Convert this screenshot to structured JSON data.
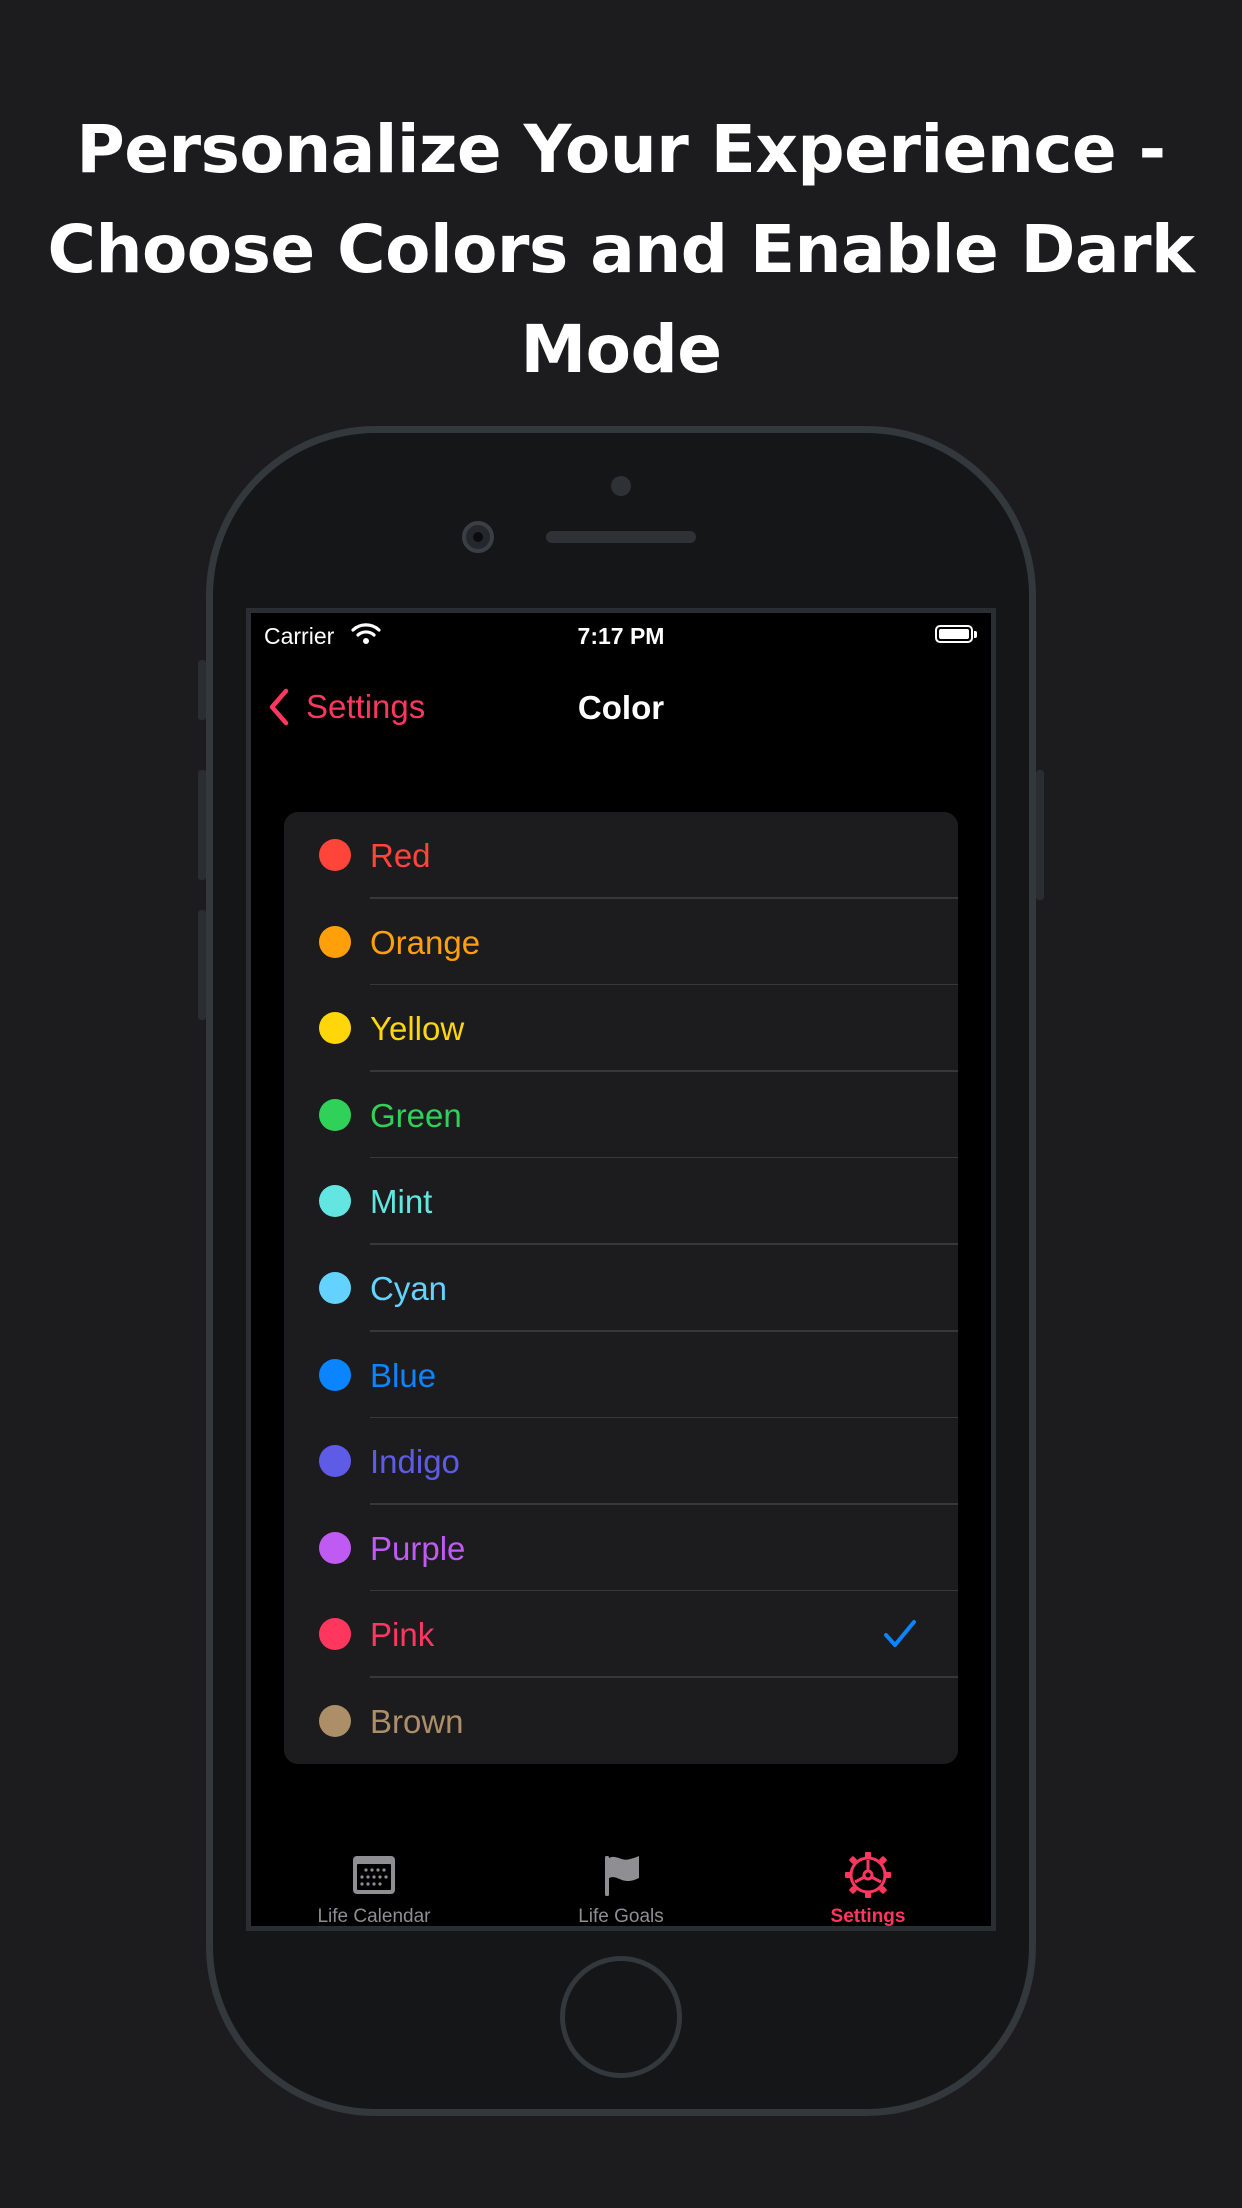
{
  "headline": {
    "line1": "Personalize Your Experience -",
    "line2": "Choose Colors and Enable Dark",
    "line3": "Mode"
  },
  "status_bar": {
    "carrier": "Carrier",
    "time": "7:17 PM",
    "wifi_icon": "wifi-icon",
    "battery_icon": "battery-icon"
  },
  "nav": {
    "back_label": "Settings",
    "back_icon": "chevron-left-icon",
    "title": "Color"
  },
  "colors": [
    {
      "label": "Red",
      "hex": "#ff453a",
      "selected": false
    },
    {
      "label": "Orange",
      "hex": "#ff9f0a",
      "selected": false
    },
    {
      "label": "Yellow",
      "hex": "#ffd60a",
      "selected": false
    },
    {
      "label": "Green",
      "hex": "#30d158",
      "selected": false
    },
    {
      "label": "Mint",
      "hex": "#63e6e2",
      "selected": false
    },
    {
      "label": "Cyan",
      "hex": "#64d2ff",
      "selected": false
    },
    {
      "label": "Blue",
      "hex": "#0a84ff",
      "selected": false
    },
    {
      "label": "Indigo",
      "hex": "#5e5ce6",
      "selected": false
    },
    {
      "label": "Purple",
      "hex": "#bf5af2",
      "selected": false
    },
    {
      "label": "Pink",
      "hex": "#ff375f",
      "selected": true
    },
    {
      "label": "Brown",
      "hex": "#ac8e68",
      "selected": false
    }
  ],
  "check_color": "#0a84ff",
  "accent": "#ff375f",
  "tabs": [
    {
      "label": "Life Calendar",
      "icon": "calendar-icon",
      "active": false
    },
    {
      "label": "Life Goals",
      "icon": "flag-icon",
      "active": false
    },
    {
      "label": "Settings",
      "icon": "gear-icon",
      "active": true
    }
  ],
  "inactive_tab_color": "#8e8e93"
}
